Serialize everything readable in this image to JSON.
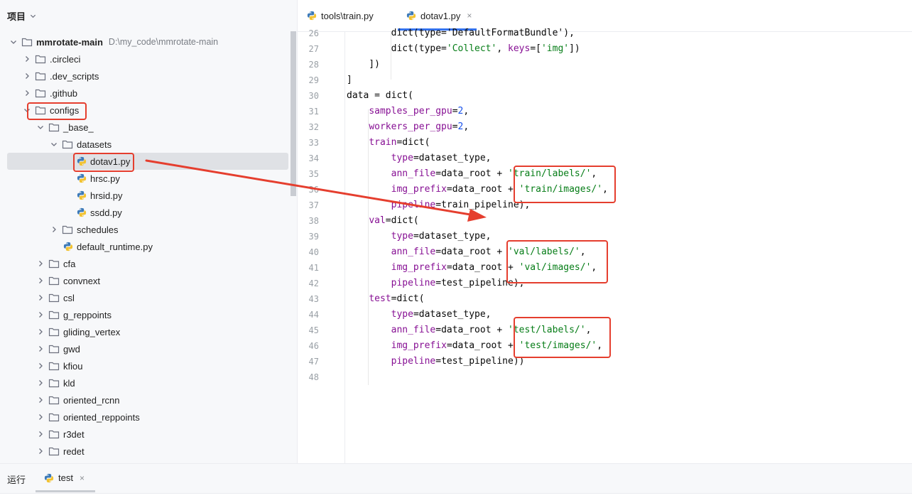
{
  "project_panel": {
    "title": "项目",
    "tree": [
      {
        "label": "mmrotate-main",
        "path": "D:\\my_code\\mmrotate-main",
        "type": "folder",
        "expanded": true,
        "bold": true
      },
      {
        "label": ".circleci",
        "type": "folder"
      },
      {
        "label": ".dev_scripts",
        "type": "folder"
      },
      {
        "label": ".github",
        "type": "folder"
      },
      {
        "label": "configs",
        "type": "folder",
        "expanded": true
      },
      {
        "label": "_base_",
        "type": "folder",
        "expanded": true
      },
      {
        "label": "datasets",
        "type": "folder",
        "expanded": true
      },
      {
        "label": "dotav1.py",
        "type": "py",
        "selected": true
      },
      {
        "label": "hrsc.py",
        "type": "py"
      },
      {
        "label": "hrsid.py",
        "type": "py"
      },
      {
        "label": "ssdd.py",
        "type": "py"
      },
      {
        "label": "schedules",
        "type": "folder"
      },
      {
        "label": "default_runtime.py",
        "type": "py"
      },
      {
        "label": "cfa",
        "type": "folder"
      },
      {
        "label": "convnext",
        "type": "folder"
      },
      {
        "label": "csl",
        "type": "folder"
      },
      {
        "label": "g_reppoints",
        "type": "folder"
      },
      {
        "label": "gliding_vertex",
        "type": "folder"
      },
      {
        "label": "gwd",
        "type": "folder"
      },
      {
        "label": "kfiou",
        "type": "folder"
      },
      {
        "label": "kld",
        "type": "folder"
      },
      {
        "label": "oriented_rcnn",
        "type": "folder"
      },
      {
        "label": "oriented_reppoints",
        "type": "folder"
      },
      {
        "label": "r3det",
        "type": "folder"
      },
      {
        "label": "redet",
        "type": "folder"
      }
    ]
  },
  "editor": {
    "tabs": [
      {
        "label": "tools\\train.py",
        "active": false
      },
      {
        "label": "dotav1.py",
        "active": true,
        "close": "×"
      }
    ],
    "lines": [
      {
        "n": "26",
        "tokens": [
          [
            "plain",
            "        dict(type='DefaultFormatBundle'),"
          ]
        ]
      },
      {
        "n": "27",
        "tokens": [
          [
            "plain",
            "        dict(type="
          ],
          [
            "str",
            "'Collect'"
          ],
          [
            "plain",
            ", "
          ],
          [
            "kw",
            "keys"
          ],
          [
            "plain",
            "=["
          ],
          [
            "str",
            "'img'"
          ],
          [
            "plain",
            "])"
          ]
        ]
      },
      {
        "n": "28",
        "tokens": [
          [
            "plain",
            "    ])"
          ]
        ]
      },
      {
        "n": "29",
        "tokens": [
          [
            "plain",
            "]"
          ]
        ]
      },
      {
        "n": "30",
        "tokens": [
          [
            "plain",
            "data = dict("
          ]
        ]
      },
      {
        "n": "31",
        "tokens": [
          [
            "plain",
            "    "
          ],
          [
            "kw",
            "samples_per_gpu"
          ],
          [
            "plain",
            "="
          ],
          [
            "num",
            "2"
          ],
          [
            "plain",
            ","
          ]
        ]
      },
      {
        "n": "32",
        "tokens": [
          [
            "plain",
            "    "
          ],
          [
            "kw",
            "workers_per_gpu"
          ],
          [
            "plain",
            "="
          ],
          [
            "num",
            "2"
          ],
          [
            "plain",
            ","
          ]
        ]
      },
      {
        "n": "33",
        "tokens": [
          [
            "plain",
            "    "
          ],
          [
            "kw",
            "train"
          ],
          [
            "plain",
            "=dict("
          ]
        ]
      },
      {
        "n": "34",
        "tokens": [
          [
            "plain",
            "        "
          ],
          [
            "kw",
            "type"
          ],
          [
            "plain",
            "=dataset_type,"
          ]
        ]
      },
      {
        "n": "35",
        "tokens": [
          [
            "plain",
            "        "
          ],
          [
            "kw",
            "ann_file"
          ],
          [
            "plain",
            "=data_root + "
          ],
          [
            "str",
            "'train/labels/'"
          ],
          [
            "plain",
            ","
          ]
        ]
      },
      {
        "n": "36",
        "tokens": [
          [
            "plain",
            "        "
          ],
          [
            "kw",
            "img_prefix"
          ],
          [
            "plain",
            "=data_root + "
          ],
          [
            "str",
            "'train/images/'"
          ],
          [
            "plain",
            ","
          ]
        ]
      },
      {
        "n": "37",
        "tokens": [
          [
            "plain",
            "        "
          ],
          [
            "kw",
            "pipeline"
          ],
          [
            "plain",
            "=train_pipeline),"
          ]
        ]
      },
      {
        "n": "38",
        "tokens": [
          [
            "plain",
            "    "
          ],
          [
            "kw",
            "val"
          ],
          [
            "plain",
            "=dict("
          ]
        ]
      },
      {
        "n": "39",
        "tokens": [
          [
            "plain",
            "        "
          ],
          [
            "kw",
            "type"
          ],
          [
            "plain",
            "=dataset_type,"
          ]
        ]
      },
      {
        "n": "40",
        "tokens": [
          [
            "plain",
            "        "
          ],
          [
            "kw",
            "ann_file"
          ],
          [
            "plain",
            "=data_root + "
          ],
          [
            "str",
            "'val/labels/'"
          ],
          [
            "plain",
            ","
          ]
        ]
      },
      {
        "n": "41",
        "tokens": [
          [
            "plain",
            "        "
          ],
          [
            "kw",
            "img_prefix"
          ],
          [
            "plain",
            "=data_root + "
          ],
          [
            "str",
            "'val/images/'"
          ],
          [
            "plain",
            ","
          ]
        ]
      },
      {
        "n": "42",
        "tokens": [
          [
            "plain",
            "        "
          ],
          [
            "kw",
            "pipeline"
          ],
          [
            "plain",
            "=test_pipeline),"
          ]
        ]
      },
      {
        "n": "43",
        "tokens": [
          [
            "plain",
            "    "
          ],
          [
            "kw",
            "test"
          ],
          [
            "plain",
            "=dict("
          ]
        ]
      },
      {
        "n": "44",
        "tokens": [
          [
            "plain",
            "        "
          ],
          [
            "kw",
            "type"
          ],
          [
            "plain",
            "=dataset_type,"
          ]
        ]
      },
      {
        "n": "45",
        "tokens": [
          [
            "plain",
            "        "
          ],
          [
            "kw",
            "ann_file"
          ],
          [
            "plain",
            "=data_root + "
          ],
          [
            "str",
            "'test/labels/'"
          ],
          [
            "plain",
            ","
          ]
        ]
      },
      {
        "n": "46",
        "tokens": [
          [
            "plain",
            "        "
          ],
          [
            "kw",
            "img_prefix"
          ],
          [
            "plain",
            "=data_root + "
          ],
          [
            "str",
            "'test/images/'"
          ],
          [
            "plain",
            ","
          ]
        ]
      },
      {
        "n": "47",
        "tokens": [
          [
            "plain",
            "        "
          ],
          [
            "kw",
            "pipeline"
          ],
          [
            "plain",
            "=test_pipeline))"
          ]
        ]
      },
      {
        "n": "48",
        "tokens": []
      }
    ]
  },
  "run_bar": {
    "title": "运行",
    "tab_label": "test",
    "tab_close": "×"
  },
  "colors": {
    "annotation": "#e53e2e",
    "accent": "#3574f0",
    "selection": "#dfe1e5"
  }
}
